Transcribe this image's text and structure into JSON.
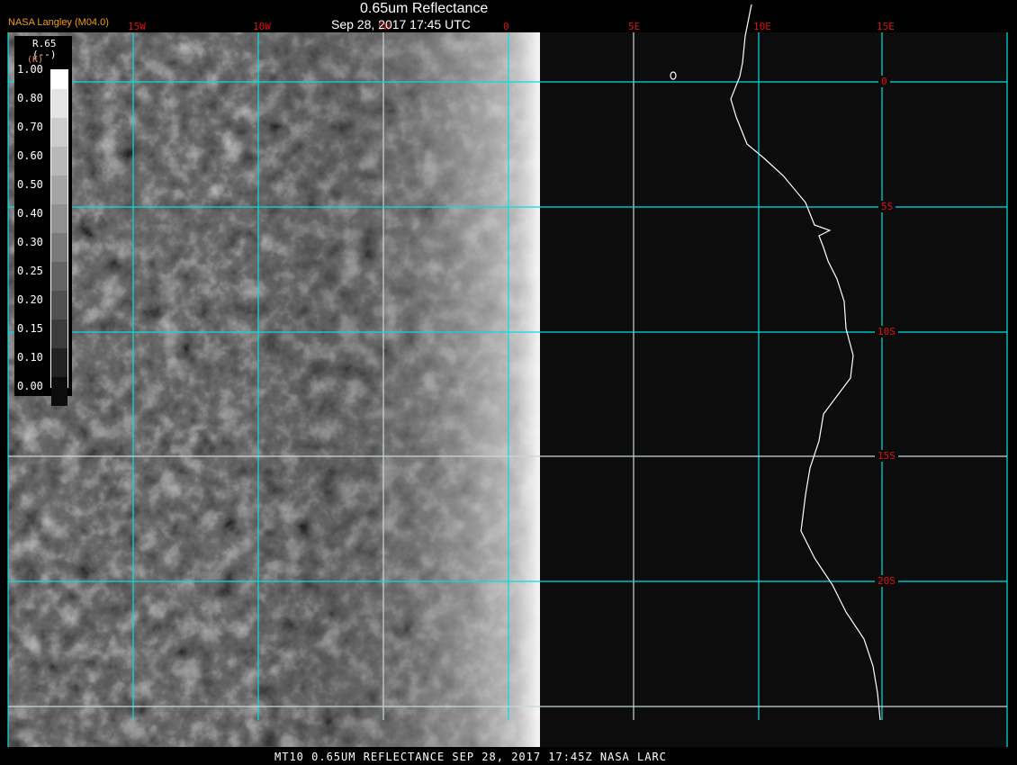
{
  "header": {
    "title": "0.65um Reflectance",
    "subtitle": "Sep 28, 2017 17:45 UTC",
    "version": "NASA Langley (M04.0)"
  },
  "footer": "MT10  0.65UM REFLECTANCE   SEP 28, 2017 17:45Z   NASA LARC",
  "grid": {
    "longitudes": [
      "15W",
      "10W",
      "5W",
      "0",
      "5E",
      "10E",
      "15E"
    ],
    "latitudes": [
      "0",
      "5S",
      "10S",
      "15S",
      "20S"
    ],
    "line_color": "#00e0e0",
    "label_color": "#e01010",
    "coastline_color": "#ffffff"
  },
  "legend": {
    "variable": "R.65",
    "units": "(--)",
    "units2": "(K)",
    "levels": [
      "1.00",
      "0.80",
      "0.70",
      "0.60",
      "0.50",
      "0.40",
      "0.30",
      "0.25",
      "0.20",
      "0.15",
      "0.10",
      "0.00"
    ],
    "colors": [
      "#ffffff",
      "#e4e4e4",
      "#cccccc",
      "#b8b8b8",
      "#a4a4a4",
      "#909090",
      "#7a7a7a",
      "#646464",
      "#505050",
      "#3c3c3c",
      "#222222",
      "#0c0c0c"
    ]
  }
}
